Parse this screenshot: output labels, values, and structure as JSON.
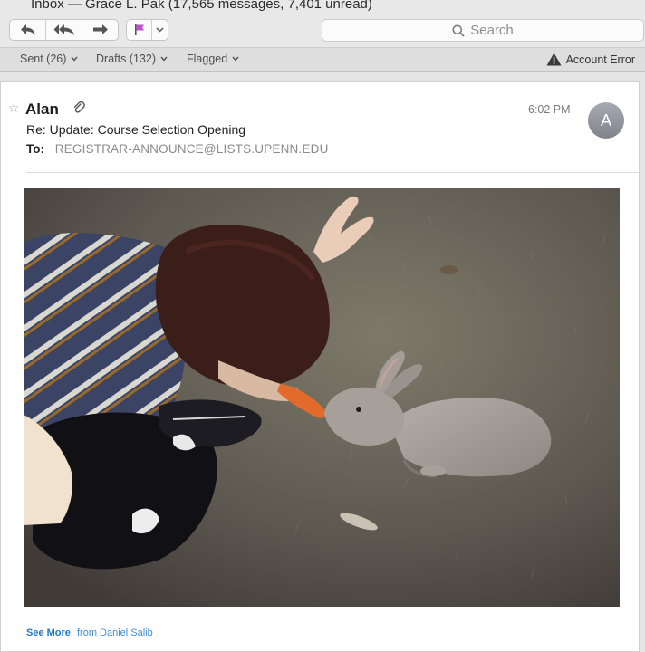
{
  "window": {
    "title": "Inbox — Grace L. Pak (17,565 messages, 7,401 unread)"
  },
  "toolbar": {
    "buttons": [
      {
        "name": "reply",
        "icon": "reply-icon"
      },
      {
        "name": "reply-all",
        "icon": "reply-all-icon"
      },
      {
        "name": "forward",
        "icon": "forward-icon"
      }
    ],
    "flag_color": "#c14fd1",
    "search_placeholder": "Search"
  },
  "favorites": {
    "items": [
      {
        "label": "Sent (26)"
      },
      {
        "label": "Drafts (132)"
      },
      {
        "label": "Flagged"
      }
    ],
    "account_error": "Account Error"
  },
  "message": {
    "sender": "Alan",
    "has_attachment": true,
    "time": "6:02 PM",
    "avatar_initial": "A",
    "subject": "Re: Update: Course Selection Opening",
    "to_label": "To:",
    "to_value": "REGISTRAR-ANNOUNCE@LISTS.UPENN.EDU",
    "footer": {
      "see_more": "See More",
      "from": "from Daniel Salib"
    }
  },
  "colors": {
    "link": "#1f7ac9",
    "avatar_bg": "#8e9099"
  }
}
